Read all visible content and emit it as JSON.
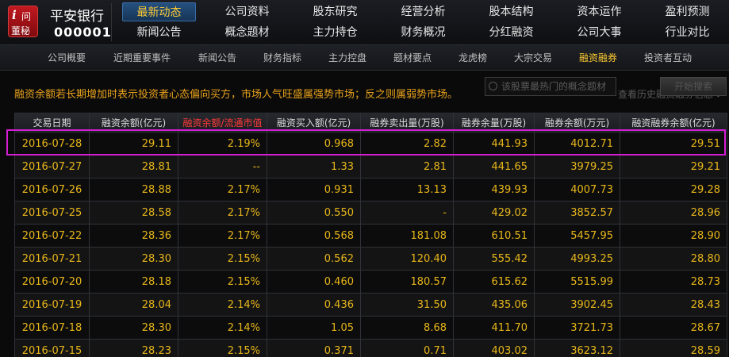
{
  "stock": {
    "name": "平安银行",
    "code": "000001"
  },
  "logo": {
    "letter": "i",
    "char1": "问",
    "char2": "董秘"
  },
  "topnav": [
    {
      "label": "最新动态",
      "active": true
    },
    {
      "label": "公司资料"
    },
    {
      "label": "股东研究"
    },
    {
      "label": "经营分析"
    },
    {
      "label": "股本结构"
    },
    {
      "label": "资本运作"
    },
    {
      "label": "盈利预测"
    },
    {
      "label": "新闻公告"
    },
    {
      "label": "概念题材"
    },
    {
      "label": "主力持仓"
    },
    {
      "label": "财务概况"
    },
    {
      "label": "分红融资"
    },
    {
      "label": "公司大事"
    },
    {
      "label": "行业对比"
    }
  ],
  "subnav": [
    {
      "label": "公司概要"
    },
    {
      "label": "近期重要事件"
    },
    {
      "label": "新闻公告"
    },
    {
      "label": "财务指标"
    },
    {
      "label": "主力控盘"
    },
    {
      "label": "题材要点"
    },
    {
      "label": "龙虎榜"
    },
    {
      "label": "大宗交易"
    },
    {
      "label": "融资融券",
      "active": true
    },
    {
      "label": "投资者互动"
    }
  ],
  "tip": "融资余额若长期增加时表示投资者心态偏向买方，市场人气旺盛属强势市场；反之则属弱势市场。",
  "search": {
    "placeholder": "该股票最热门的概念题材",
    "button": "开始搜索",
    "history": "查看历史融资融券信息 >"
  },
  "colors": {
    "data_text": "#e8b71a",
    "highlight_header": "#ff3b3b",
    "active_nav": "#ffcc33",
    "highlight_frame": "#d41ed4"
  },
  "table": {
    "headers": [
      "交易日期",
      "融资余额(亿元)",
      "融资余额/流通市值",
      "融资买入额(亿元)",
      "融券卖出量(万股)",
      "融券余量(万股)",
      "融券余额(万元)",
      "融资融券余额(亿元)"
    ],
    "rows": [
      [
        "2016-07-28",
        "29.11",
        "2.19%",
        "0.968",
        "2.82",
        "441.93",
        "4012.71",
        "29.51"
      ],
      [
        "2016-07-27",
        "28.81",
        "--",
        "1.33",
        "2.81",
        "441.65",
        "3979.25",
        "29.21"
      ],
      [
        "2016-07-26",
        "28.88",
        "2.17%",
        "0.931",
        "13.13",
        "439.93",
        "4007.73",
        "29.28"
      ],
      [
        "2016-07-25",
        "28.58",
        "2.17%",
        "0.550",
        "-",
        "429.02",
        "3852.57",
        "28.96"
      ],
      [
        "2016-07-22",
        "28.36",
        "2.17%",
        "0.568",
        "181.08",
        "610.51",
        "5457.95",
        "28.90"
      ],
      [
        "2016-07-21",
        "28.30",
        "2.15%",
        "0.562",
        "120.40",
        "555.42",
        "4993.25",
        "28.80"
      ],
      [
        "2016-07-20",
        "28.18",
        "2.15%",
        "0.460",
        "180.57",
        "615.62",
        "5515.99",
        "28.73"
      ],
      [
        "2016-07-19",
        "28.04",
        "2.14%",
        "0.436",
        "31.50",
        "435.06",
        "3902.45",
        "28.43"
      ],
      [
        "2016-07-18",
        "28.30",
        "2.14%",
        "1.05",
        "8.68",
        "411.70",
        "3721.73",
        "28.67"
      ],
      [
        "2016-07-15",
        "28.23",
        "2.15%",
        "0.371",
        "0.71",
        "403.02",
        "3623.12",
        "28.59"
      ]
    ]
  }
}
